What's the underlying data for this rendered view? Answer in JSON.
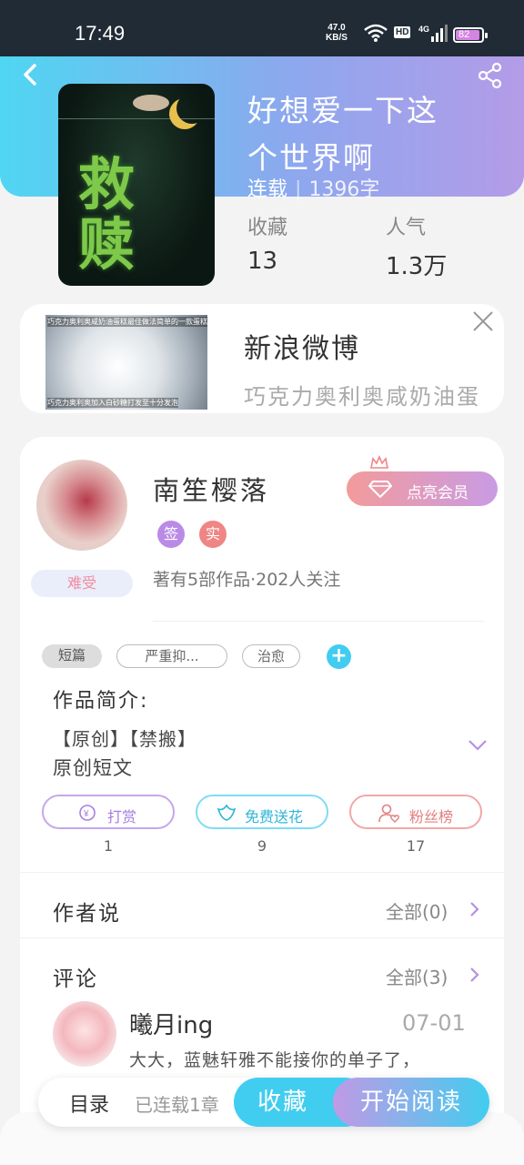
{
  "status_bar": {
    "time": "17:49",
    "net_speed": "47.0",
    "net_unit": "KB/S",
    "hd": "HD",
    "signal": "4G",
    "battery": "82"
  },
  "book": {
    "title_line1": "好想爱一下这",
    "title_line2": "个世界啊",
    "status": "连载",
    "word_count": "1396字",
    "cover_art": "救赎",
    "stats": {
      "favorites_label": "收藏",
      "favorites_value": "13",
      "popularity_label": "人气",
      "popularity_value": "1.3万"
    }
  },
  "ad": {
    "title": "新浪微博",
    "description": "巧克力奥利奥咸奶油蛋",
    "thumb_caption_top": "巧克力奥利奥咸奶油蛋糕最佳做法简单的一款蛋糕",
    "thumb_caption_bottom": "巧克力奥利奥加入白砂糖打发至十分发泡"
  },
  "author": {
    "name": "南笙樱落",
    "mood": "难受",
    "badge_sign": "签",
    "badge_real": "实",
    "stats_text": "著有5部作品·202人关注",
    "vip_label": "点亮会员"
  },
  "tags": {
    "primary": "短篇",
    "items": [
      "严重抑...",
      "治愈"
    ],
    "add": "+"
  },
  "intro": {
    "title": "作品简介:",
    "line1": "【原创】【禁搬】",
    "line2": "原创短文"
  },
  "actions": [
    {
      "label": "打赏",
      "count": "1"
    },
    {
      "label": "免费送花",
      "count": "9"
    },
    {
      "label": "粉丝榜",
      "count": "17"
    }
  ],
  "author_says": {
    "title": "作者说",
    "link": "全部(0)"
  },
  "comments": {
    "title": "评论",
    "link": "全部(3)",
    "items": [
      {
        "user": "曦月ing",
        "date": "07-01",
        "text": "大大，蓝魅轩雅不能接你的单子了，"
      }
    ]
  },
  "bottom_bar": {
    "toc_label": "目录",
    "toc_status": "已连载1章",
    "favorite": "收藏",
    "read": "开始阅读"
  },
  "colors": {
    "accent_cyan": "#41cdef",
    "accent_purple": "#c09ae6",
    "vip_pink": "#f39b9b",
    "reward_purple": "#b591e3",
    "flower_cyan": "#41cdef",
    "fans_pink": "#ef8e8e"
  },
  "icons": {
    "back": "back-icon",
    "share": "share-icon",
    "close": "close-icon",
    "expand": "chevron-down-icon",
    "chevron": "chevron-right-icon"
  }
}
